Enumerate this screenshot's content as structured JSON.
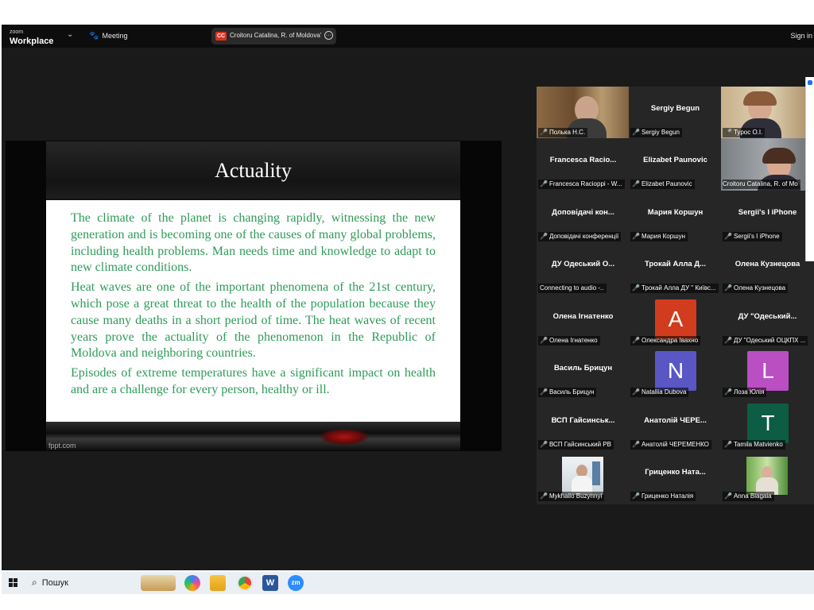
{
  "window": {
    "brand_small": "zoom",
    "brand": "Workplace",
    "meeting_label": "Meeting",
    "share_badge": "CC",
    "share_name": "Croitoru Catalina, R. of Moldova'",
    "signin_label": "Sign in"
  },
  "slide": {
    "title": "Actuality",
    "paragraphs": [
      "The climate of the planet is changing rapidly, witnessing the new generation and is becoming one of the causes of many global problems, including health problems. Man needs time and knowledge to adapt to new climate conditions.",
      "Heat waves are one of the important phenomena of the 21st century, which pose a great threat to the health of the population because they cause many deaths in a short period of time. The heat waves of recent years prove the actuality of the phenomenon in the Republic of Moldova and neighboring countries.",
      "Episodes of extreme temperatures have a significant impact on health and are a challenge for every person, healthy or ill."
    ],
    "footer": "fppt.com"
  },
  "gallery": {
    "tiles": [
      {
        "name": "",
        "label": "Полька Н.С.",
        "muted": true,
        "kind": "photo"
      },
      {
        "name": "Sergiy Begun",
        "label": "Sergiy Begun",
        "muted": true,
        "kind": "name"
      },
      {
        "name": "",
        "label": "Турос О.І.",
        "muted": true,
        "kind": "photo"
      },
      {
        "name": "Francesca Racio...",
        "label": "Francesca Racioppi - W...",
        "muted": true,
        "kind": "name"
      },
      {
        "name": "Elizabet Paunovic",
        "label": "Elizabet Paunovic",
        "muted": true,
        "kind": "name"
      },
      {
        "name": "",
        "label": "Croitoru Catalina, R. of Mo",
        "muted": false,
        "kind": "photo",
        "active": true
      },
      {
        "name": "Доповідачі кон...",
        "label": "Доповідачі конференції",
        "muted": true,
        "kind": "name"
      },
      {
        "name": "Мария Коршун",
        "label": "Мария Коршун",
        "muted": true,
        "kind": "name"
      },
      {
        "name": "Sergii's I iPhone",
        "label": "Sergii's I iPhone",
        "muted": true,
        "kind": "name"
      },
      {
        "name": "ДУ Одеський О...",
        "label": "Connecting to audio -..",
        "muted": false,
        "kind": "name"
      },
      {
        "name": "Трокай Алла Д...",
        "label": "Трокай Алла ДУ \" Київс...",
        "muted": true,
        "kind": "name"
      },
      {
        "name": "Олена Кузнецова",
        "label": "Олена Кузнецова",
        "muted": true,
        "kind": "name"
      },
      {
        "name": "Олена Ігнатенко",
        "label": "Олена Ігнатенко",
        "muted": true,
        "kind": "name"
      },
      {
        "name": "",
        "label": "Олександра Івахно",
        "muted": true,
        "kind": "letter",
        "letter": "A",
        "color": "#d23c1e"
      },
      {
        "name": "ДУ \"Одеський...",
        "label": "ДУ \"Одеський ОЦКПХ ...",
        "muted": true,
        "kind": "name"
      },
      {
        "name": "Василь Брицун",
        "label": "Василь Брицун",
        "muted": true,
        "kind": "name"
      },
      {
        "name": "",
        "label": "Nataliia Dubova",
        "muted": true,
        "kind": "letter",
        "letter": "N",
        "color": "#5a56c4"
      },
      {
        "name": "",
        "label": "Лоза Юлія",
        "muted": true,
        "kind": "letter",
        "letter": "L",
        "color": "#b94fc2"
      },
      {
        "name": "ВСП Гайсинськ...",
        "label": "ВСП Гайсинський РВ",
        "muted": true,
        "kind": "name"
      },
      {
        "name": "Анатолій ЧЕРЕ...",
        "label": "Анатолій ЧЕРЕМЕНКО",
        "muted": true,
        "kind": "name"
      },
      {
        "name": "",
        "label": "Tamila Matvienko",
        "muted": true,
        "kind": "letter",
        "letter": "T",
        "color": "#0d5c44"
      },
      {
        "name": "",
        "label": "Mykhailo Buzynnyi",
        "muted": true,
        "kind": "photo"
      },
      {
        "name": "Гриценко Ната...",
        "label": "Гриценко Наталія",
        "muted": true,
        "kind": "name"
      },
      {
        "name": "",
        "label": "Anna Blagaia",
        "muted": true,
        "kind": "photo"
      }
    ]
  },
  "taskbar": {
    "search_label": "Пошук",
    "icons": [
      "windows-start",
      "search",
      "house-widget",
      "copilot",
      "file-explorer",
      "chrome",
      "word",
      "zoom"
    ]
  }
}
